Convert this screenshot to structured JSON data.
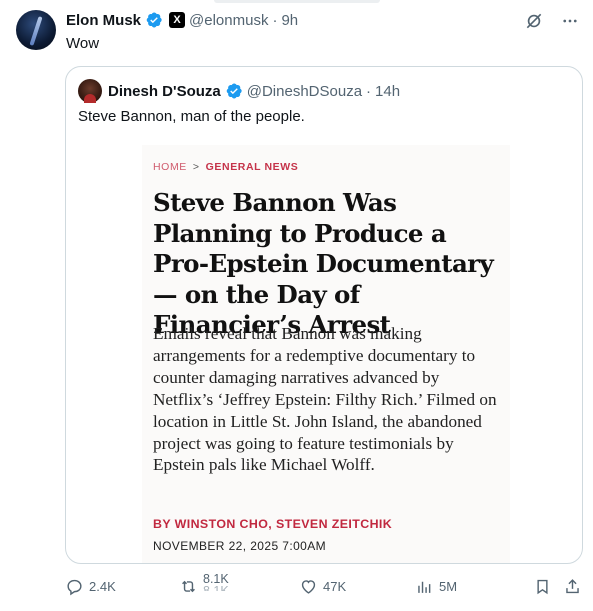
{
  "tweet": {
    "author_name": "Elon Musk",
    "handle": "@elonmusk",
    "separator": "·",
    "time": "9h",
    "text": "Wow",
    "x_badge": "X",
    "icons": {
      "grok": "grok-slash-icon",
      "more": "more-dots-icon"
    }
  },
  "quote": {
    "author_name": "Dinesh D'Souza",
    "handle": "@DineshDSouza",
    "separator": "·",
    "time": "14h",
    "text": "Steve Bannon, man of the people."
  },
  "article": {
    "breadcrumb_home": "HOME",
    "breadcrumb_sep": ">",
    "breadcrumb_category": "GENERAL NEWS",
    "headline": "Steve Bannon Was Planning to Produce a Pro-Epstein Documentary — on the Day of Financier’s Arrest",
    "dek": "Emails reveal that Bannon was making arrangements for a redemptive documentary to counter damaging narratives advanced by Netflix’s ‘Jeffrey Epstein: Filthy Rich.’ Filmed on location in Little St. John Island, the abandoned project was going to feature testimonials by Epstein pals like Michael Wolff.",
    "byline": "BY WINSTON CHO, STEVEN ZEITCHIK",
    "date": "NOVEMBER 22, 2025 7:00AM"
  },
  "actions": {
    "replies": "2.4K",
    "reposts": "8.1K",
    "reposts_ghost": "8.1K",
    "likes": "47K",
    "views": "5M"
  },
  "colors": {
    "verified": "#1d9bf0",
    "muted": "#536471",
    "accent_red": "#c1283f"
  }
}
